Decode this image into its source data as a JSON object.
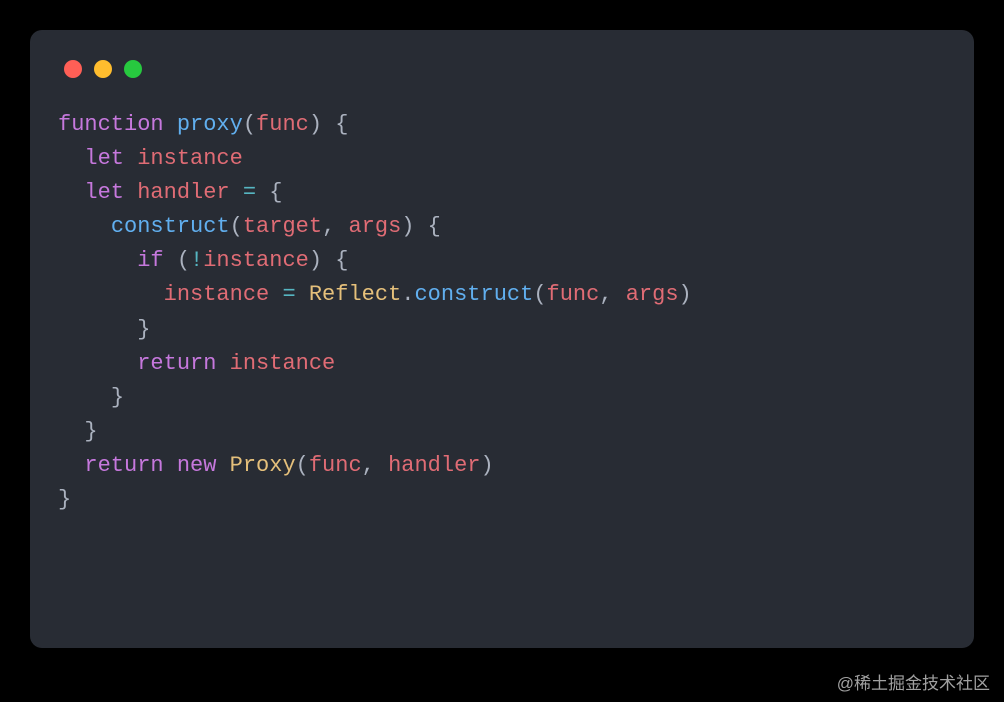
{
  "colors": {
    "page_bg": "#000000",
    "card_bg": "#282c34",
    "text_default": "#abb2bf",
    "keyword": "#c678dd",
    "function_def": "#61afef",
    "identifier": "#e06c75",
    "classname": "#e5c07b",
    "operator": "#56b6c2",
    "traffic_red": "#ff5f56",
    "traffic_yellow": "#ffbd2e",
    "traffic_green": "#27c93f"
  },
  "code": {
    "line1": {
      "kw1": "function",
      "sp1": " ",
      "fn": "proxy",
      "p1": "(",
      "arg": "func",
      "p2": ") {"
    },
    "line2": {
      "indent": "  ",
      "kw": "let",
      "sp": " ",
      "id": "instance"
    },
    "line3": {
      "indent": "  ",
      "kw": "let",
      "sp": " ",
      "id": "handler",
      "sp2": " ",
      "op": "=",
      "sp3": " ",
      "brace": "{"
    },
    "line4": {
      "indent": "    ",
      "fn": "construct",
      "p1": "(",
      "a1": "target",
      "comma": ", ",
      "a2": "args",
      "p2": ") {"
    },
    "line5": {
      "indent": "      ",
      "kw": "if",
      "sp": " ",
      "p1": "(",
      "neg": "!",
      "id": "instance",
      "p2": ") {"
    },
    "line6": {
      "indent": "        ",
      "id": "instance",
      "sp": " ",
      "op": "=",
      "sp2": " ",
      "cls": "Reflect",
      "dot": ".",
      "fn": "construct",
      "p1": "(",
      "a1": "func",
      "comma": ", ",
      "a2": "args",
      "p2": ")"
    },
    "line7": {
      "indent": "      ",
      "brace": "}"
    },
    "line8": {
      "indent": "      ",
      "kw": "return",
      "sp": " ",
      "id": "instance"
    },
    "line9": {
      "indent": "    ",
      "brace": "}"
    },
    "line10": {
      "indent": "  ",
      "brace": "}"
    },
    "line11": {
      "indent": "  ",
      "kw": "return",
      "sp": " ",
      "kw2": "new",
      "sp2": " ",
      "cls": "Proxy",
      "p1": "(",
      "a1": "func",
      "comma": ", ",
      "a2": "handler",
      "p2": ")"
    },
    "line12": {
      "brace": "}"
    }
  },
  "watermark": "@稀土掘金技术社区"
}
